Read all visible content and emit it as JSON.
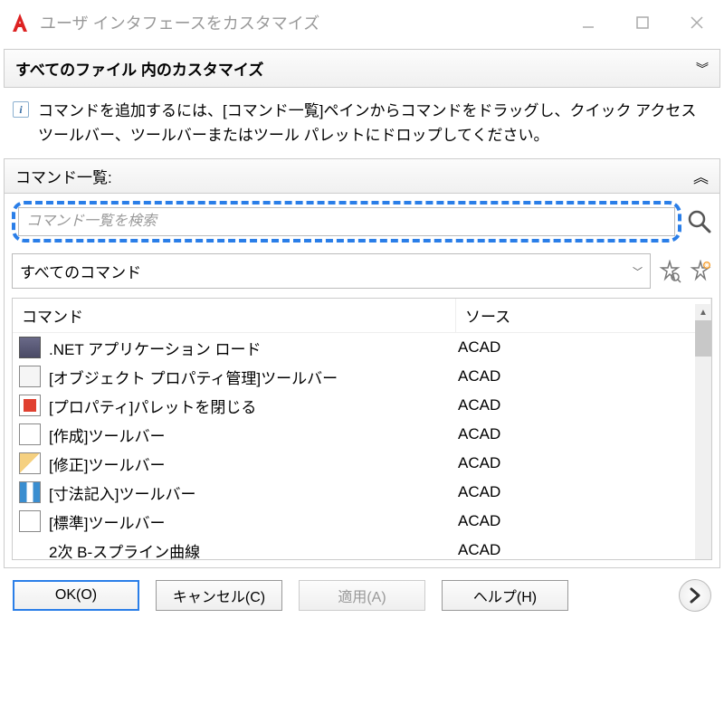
{
  "window": {
    "title": "ユーザ インタフェースをカスタマイズ"
  },
  "sections": {
    "all_files": {
      "label": "すべてのファイル 内のカスタマイズ"
    }
  },
  "info": {
    "text": "コマンドを追加するには、[コマンド一覧]ペインからコマンドをドラッグし、クイック アクセス ツールバー、ツールバーまたはツール パレットにドロップしてください。"
  },
  "command_panel": {
    "header": "コマンド一覧:",
    "search_placeholder": "コマンド一覧を検索",
    "filter": "すべてのコマンド"
  },
  "columns": {
    "command": "コマンド",
    "source": "ソース"
  },
  "rows": [
    {
      "label": ".NET アプリケーション ロード",
      "source": "ACAD",
      "icon": "net"
    },
    {
      "label": "[オブジェクト プロパティ管理]ツールバー",
      "source": "ACAD",
      "icon": "obj"
    },
    {
      "label": "[プロパティ]パレットを閉じる",
      "source": "ACAD",
      "icon": "close"
    },
    {
      "label": "[作成]ツールバー",
      "source": "ACAD",
      "icon": "create"
    },
    {
      "label": "[修正]ツールバー",
      "source": "ACAD",
      "icon": "edit"
    },
    {
      "label": "[寸法記入]ツールバー",
      "source": "ACAD",
      "icon": "dim"
    },
    {
      "label": "[標準]ツールバー",
      "source": "ACAD",
      "icon": "std"
    },
    {
      "label": "2次 B-スプライン曲線",
      "source": "ACAD",
      "icon": ""
    }
  ],
  "buttons": {
    "ok": "OK(O)",
    "cancel": "キャンセル(C)",
    "apply": "適用(A)",
    "help": "ヘルプ(H)"
  }
}
